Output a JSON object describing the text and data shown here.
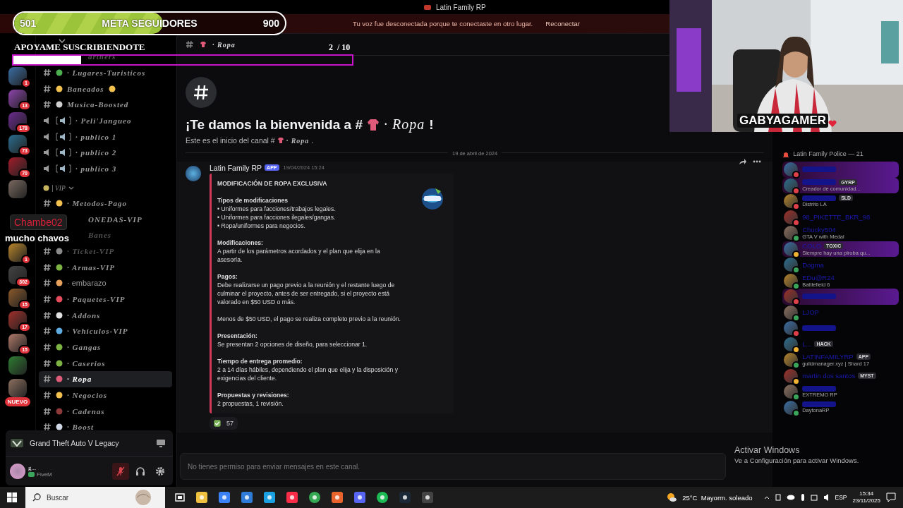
{
  "window": {
    "title": "Latin Family RP"
  },
  "notice": {
    "text": "Tu voz fue desconectada porque te conectaste en otro lugar.",
    "action": "Reconectar"
  },
  "overlay": {
    "goal": {
      "current": "501",
      "label": "META SEGUIDORES",
      "target": "900",
      "level": 0.55
    },
    "subs": {
      "label": "APOYAME SUSCRIBIENDOTE",
      "count": "2",
      "total": "/ 10",
      "level": 0.2
    },
    "chat": {
      "user": "Chambe02",
      "message": "mucho chavos"
    },
    "webcam": {
      "kind": "picture",
      "logo": "GABYAGAMER"
    }
  },
  "servers": [
    {
      "kind": "server",
      "badge": "1"
    },
    {
      "kind": "server",
      "badge": "13"
    },
    {
      "kind": "server",
      "badge": "178"
    },
    {
      "kind": "server",
      "badge": "73"
    },
    {
      "kind": "server",
      "badge": "70"
    },
    {
      "kind": "server"
    },
    {
      "kind": "server",
      "badge": "1"
    },
    {
      "kind": "server",
      "badge": "302"
    },
    {
      "kind": "server",
      "badge": "15"
    },
    {
      "kind": "server",
      "badge": "17"
    },
    {
      "kind": "server",
      "badge": "15"
    },
    {
      "kind": "server"
    },
    {
      "kind": "server"
    },
    {
      "kind": "new",
      "label": "NUEVO"
    }
  ],
  "channels": [
    {
      "kind": "partial",
      "name": "artners",
      "selected": false,
      "muted": true,
      "fancy": true
    },
    {
      "kind": "text",
      "name": "· Lugares-Turisticos",
      "color": "#4caf50",
      "selected": false,
      "muted": false,
      "fancy": true
    },
    {
      "kind": "text",
      "name": "Baneados",
      "color": "#f2c14e",
      "selected": false,
      "muted": false,
      "fancy": true,
      "icon_after": true
    },
    {
      "kind": "text",
      "name": "Musica-Boosted",
      "color": "#cfcfcf",
      "selected": false,
      "muted": false,
      "fancy": true
    },
    {
      "kind": "voice",
      "name": "· Peli'Jangueo",
      "selected": false,
      "muted": false,
      "fancy": true
    },
    {
      "kind": "voice",
      "name": "· publico 1",
      "selected": false,
      "muted": false,
      "fancy": true
    },
    {
      "kind": "voice",
      "name": "· publico 2",
      "selected": false,
      "muted": false,
      "fancy": true
    },
    {
      "kind": "voice",
      "name": "· publico 3",
      "selected": false,
      "muted": false,
      "fancy": true
    },
    {
      "kind": "category",
      "name": "VIP"
    },
    {
      "kind": "text",
      "name": "· Metodos-Pago",
      "color": "#f2c14e",
      "selected": false,
      "muted": false,
      "fancy": true
    },
    {
      "kind": "partial",
      "name": "ONEDAS-VIP",
      "selected": false,
      "muted": false,
      "fancy": true
    },
    {
      "kind": "partial",
      "name": "Banes",
      "selected": false,
      "muted": true,
      "fancy": true
    },
    {
      "kind": "text",
      "name": "· Ticket-VIP",
      "color": "#8a8a8a",
      "selected": false,
      "muted": true,
      "fancy": true
    },
    {
      "kind": "text",
      "name": "· Armas-VIP",
      "color": "#7cb342",
      "selected": false,
      "muted": false,
      "fancy": true
    },
    {
      "kind": "text",
      "name": "· embarazo",
      "color": "#e8a25c",
      "selected": false,
      "muted": false,
      "fancy": false
    },
    {
      "kind": "text",
      "name": "· Paquetes-VIP",
      "color": "#e74c5c",
      "selected": false,
      "muted": false,
      "fancy": true
    },
    {
      "kind": "text",
      "name": "· Addons",
      "color": "#e0e0e0",
      "selected": false,
      "muted": false,
      "fancy": true
    },
    {
      "kind": "text",
      "name": "· Vehiculos-VIP",
      "color": "#5dade2",
      "selected": false,
      "muted": false,
      "fancy": true
    },
    {
      "kind": "text",
      "name": "· Gangas",
      "color": "#7cb342",
      "selected": false,
      "muted": false,
      "fancy": true
    },
    {
      "kind": "text",
      "name": "· Caserios",
      "color": "#7cb342",
      "selected": false,
      "muted": false,
      "fancy": true
    },
    {
      "kind": "text",
      "name": "· Ropa",
      "color": "#e05a7a",
      "selected": true,
      "muted": false,
      "fancy": true
    },
    {
      "kind": "text",
      "name": "· Negocios",
      "color": "#f2c14e",
      "selected": false,
      "muted": false,
      "fancy": true
    },
    {
      "kind": "text",
      "name": "· Cadenas",
      "color": "#8e3a3a",
      "selected": false,
      "muted": false,
      "fancy": true
    },
    {
      "kind": "text",
      "name": "· Boost",
      "color": "#d0d8e8",
      "selected": false,
      "muted": false,
      "fancy": true
    }
  ],
  "activity": {
    "game": "Grand Theft Auto V Legacy"
  },
  "user": {
    "name": "g...",
    "status": "FiveM",
    "muted": true
  },
  "chat": {
    "channel": "· Ropa",
    "welcome": {
      "before": "¡Te damos la bienvenida a #",
      "channel": "· Ropa",
      "after": "!",
      "sub_before": "Este es el inicio del canal #",
      "sub_channel": "· Ropa",
      "sub_after": "."
    },
    "date": "19 de abril de 2024",
    "message": {
      "author": "Latin Family RP",
      "badge": "APP",
      "time": "19/04/2024 15:24",
      "embed": {
        "title": "MODIFICACIÓN DE ROPA EXCLUSIVA",
        "sections": [
          {
            "heading": "Tipos de modificaciones",
            "lines": [
              "• Uniformes para facciones/trabajos legales.",
              "• Uniformes para facciones ilegales/gangas.",
              "• Ropa/uniformes para negocios."
            ]
          },
          {
            "heading": "Modificaciones:",
            "lines": [
              "A partir de los parámetros acordados y el plan que elija en la asesoría."
            ]
          },
          {
            "heading": "Pagos:",
            "lines": [
              "Debe realizarse un pago previo a la reunión y el restante luego de culminar el proyecto, antes de ser entregado, si el proyecto está valorado en $50 USD o más."
            ]
          },
          {
            "lines": [
              "Menos de $50 USD, el pago se realiza completo previo a la reunión."
            ]
          },
          {
            "heading": "Presentación:",
            "lines": [
              "Se presentan 2 opciones de diseño, para seleccionar 1."
            ]
          },
          {
            "heading": "Tiempo de entrega promedio:",
            "lines": [
              "2 a 14 días hábiles, dependiendo el plan que elija y la disposición y exigencias del cliente."
            ]
          },
          {
            "heading": "Propuestas y revisiones:",
            "lines": [
              "2 propuestas, 1 revisión."
            ]
          }
        ]
      },
      "reaction": {
        "count": "57"
      }
    },
    "input": {
      "placeholder": "No tienes permiso para enviar mensajes en este canal."
    }
  },
  "members": {
    "header": "Latin Family Police — 21",
    "items": [
      {
        "color": "#e0404a",
        "highlighted": true
      },
      {
        "color": "#e0404a",
        "badge": "GYRP",
        "activity": "Creador de comunidad...",
        "highlighted": true
      },
      {
        "color": "#e0404a",
        "badge": "SLD",
        "activity": "Distrito LA",
        "highlighted": false
      },
      {
        "name": "98_PIKETTE_BKR_98",
        "color": "#e0404a",
        "highlighted": false
      },
      {
        "name": "Chucky504",
        "color": "#3ba55c",
        "activity": "GTA V with Medal",
        "highlighted": false
      },
      {
        "name": "COLO",
        "color": "#f0b232",
        "badge": "TOXIC",
        "activity": "Siempre hay una piroba qu...",
        "highlighted": true
      },
      {
        "name": "Dogma",
        "color": "#3ba55c",
        "highlighted": false
      },
      {
        "name": "EDu@R24",
        "color": "#3ba55c",
        "activity": "Battlefield 6",
        "highlighted": false
      },
      {
        "color": "#e0404a",
        "highlighted": true
      },
      {
        "name": "LJOP",
        "color": "#3ba55c",
        "highlighted": false
      },
      {
        "color": "#e0404a",
        "highlighted": false
      },
      {
        "name": "L...",
        "color": "#f0b232",
        "badge": "HACK",
        "highlighted": false
      },
      {
        "name": "LATINFAMILYRP",
        "color": "#3ba55c",
        "badge": "APP",
        "activity": "guildmanager.xyz | Shard 17",
        "highlighted": false
      },
      {
        "name": "martin dos santos",
        "color": "#f0b232",
        "badge": "MYST",
        "highlighted": false
      },
      {
        "color": "#3ba55c",
        "activity": "EXTREMO RP",
        "highlighted": false
      },
      {
        "color": "#3ba55c",
        "activity": "DaytonaRP",
        "highlighted": false
      }
    ]
  },
  "watermark": {
    "title": "Activar Windows",
    "text": "Ve a Configuración para activar Windows."
  },
  "taskbar": {
    "search": "Buscar",
    "weather": "25°C  Mayorm. soleado",
    "language": "ESP",
    "time": "15:34",
    "date": "23/11/2025"
  }
}
